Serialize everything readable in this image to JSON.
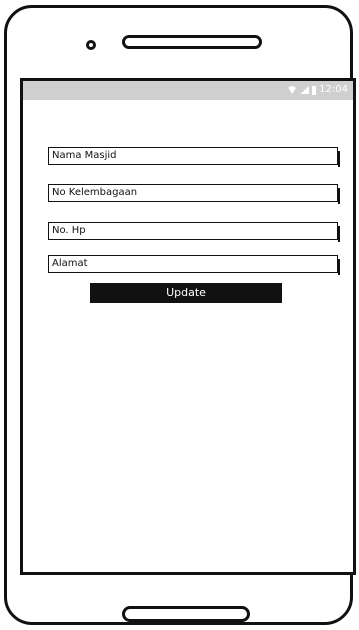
{
  "status_bar": {
    "time": "12:04"
  },
  "form": {
    "nama_masjid_placeholder": "Nama Masjid",
    "no_kelembagaan_placeholder": "No Kelembagaan",
    "no_hp_placeholder": "No. Hp",
    "alamat_placeholder": "Alamat",
    "update_label": "Update"
  },
  "colors": {
    "status_bar_bg": "#cfcfcf",
    "button_bg": "#111111",
    "button_text": "#ffffff"
  }
}
